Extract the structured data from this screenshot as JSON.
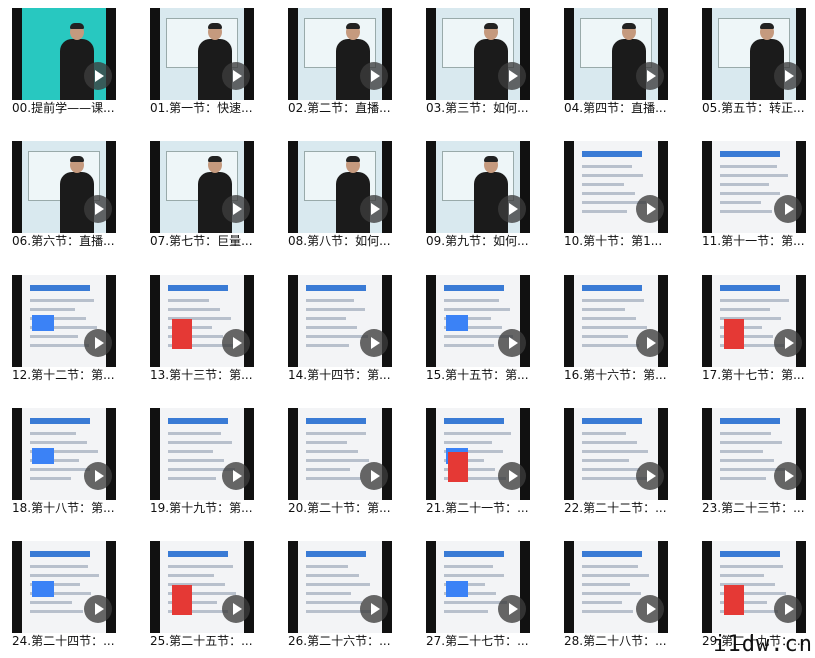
{
  "videos": [
    {
      "title": "00.提前学——课...",
      "style": "teal"
    },
    {
      "title": "01.第一节：快速...",
      "style": "video"
    },
    {
      "title": "02.第二节：直播...",
      "style": "video"
    },
    {
      "title": "03.第三节：如何...",
      "style": "video"
    },
    {
      "title": "04.第四节：直播...",
      "style": "video"
    },
    {
      "title": "05.第五节：转正...",
      "style": "video"
    },
    {
      "title": "06.第六节：直播...",
      "style": "video"
    },
    {
      "title": "07.第七节：巨量...",
      "style": "video"
    },
    {
      "title": "08.第八节：如何...",
      "style": "video"
    },
    {
      "title": "09.第九节：如何...",
      "style": "video"
    },
    {
      "title": "10.第十节：第1...",
      "style": "slide"
    },
    {
      "title": "11.第十一节：第...",
      "style": "slide"
    },
    {
      "title": "12.第十二节：第...",
      "style": "slide"
    },
    {
      "title": "13.第十三节：第...",
      "style": "slide"
    },
    {
      "title": "14.第十四节：第...",
      "style": "slide"
    },
    {
      "title": "15.第十五节：第...",
      "style": "slide"
    },
    {
      "title": "16.第十六节：第...",
      "style": "slide"
    },
    {
      "title": "17.第十七节：第...",
      "style": "slide"
    },
    {
      "title": "18.第十八节：第...",
      "style": "slide"
    },
    {
      "title": "19.第十九节：第...",
      "style": "slide"
    },
    {
      "title": "20.第二十节：第...",
      "style": "slide"
    },
    {
      "title": "21.第二十一节：...",
      "style": "slide"
    },
    {
      "title": "22.第二十二节：...",
      "style": "slide"
    },
    {
      "title": "23.第二十三节：...",
      "style": "slide"
    },
    {
      "title": "24.第二十四节：...",
      "style": "slide"
    },
    {
      "title": "25.第二十五节：...",
      "style": "slide"
    },
    {
      "title": "26.第二十六节：...",
      "style": "slide"
    },
    {
      "title": "27.第二十七节：...",
      "style": "slide"
    },
    {
      "title": "28.第二十八节：...",
      "style": "slide"
    },
    {
      "title": "29.第二十九节：...",
      "style": "slide"
    }
  ],
  "watermark": "i1dw.cn"
}
